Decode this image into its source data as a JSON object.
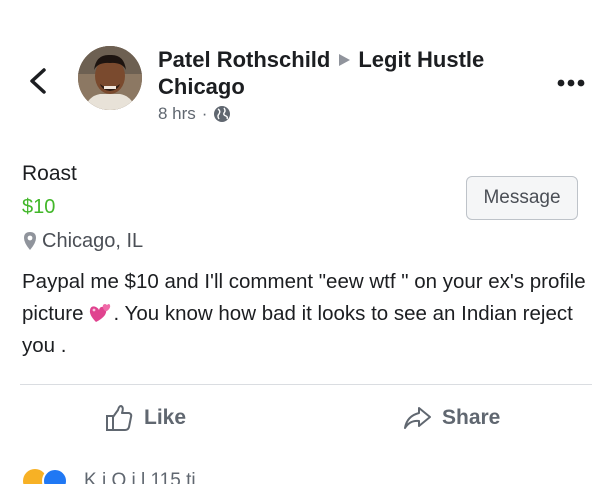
{
  "header": {
    "author": "Patel Rothschild",
    "group_line1": "Legit Hustle",
    "group_line2": "Chicago",
    "time": "8 hrs",
    "separator": "·",
    "privacy_icon": "globe-icon",
    "back_icon": "chevron-left-icon",
    "more_icon": "more-horizontal-icon"
  },
  "listing": {
    "title": "Roast",
    "price": "$10",
    "location": "Chicago, IL",
    "message_label": "Message",
    "price_color": "#42b72a"
  },
  "post": {
    "text_before_emoji": "Paypal me $10 and I'll comment  \"eew wtf \" on your ex's profile picture",
    "emoji": "two-hearts-emoji",
    "text_after_emoji": ". You know how bad it looks to see an Indian reject you ."
  },
  "actions": {
    "like_label": "Like",
    "share_label": "Share"
  },
  "footer": {
    "reactions_text_partial": "K   i   Q   i   l   115   ti"
  }
}
